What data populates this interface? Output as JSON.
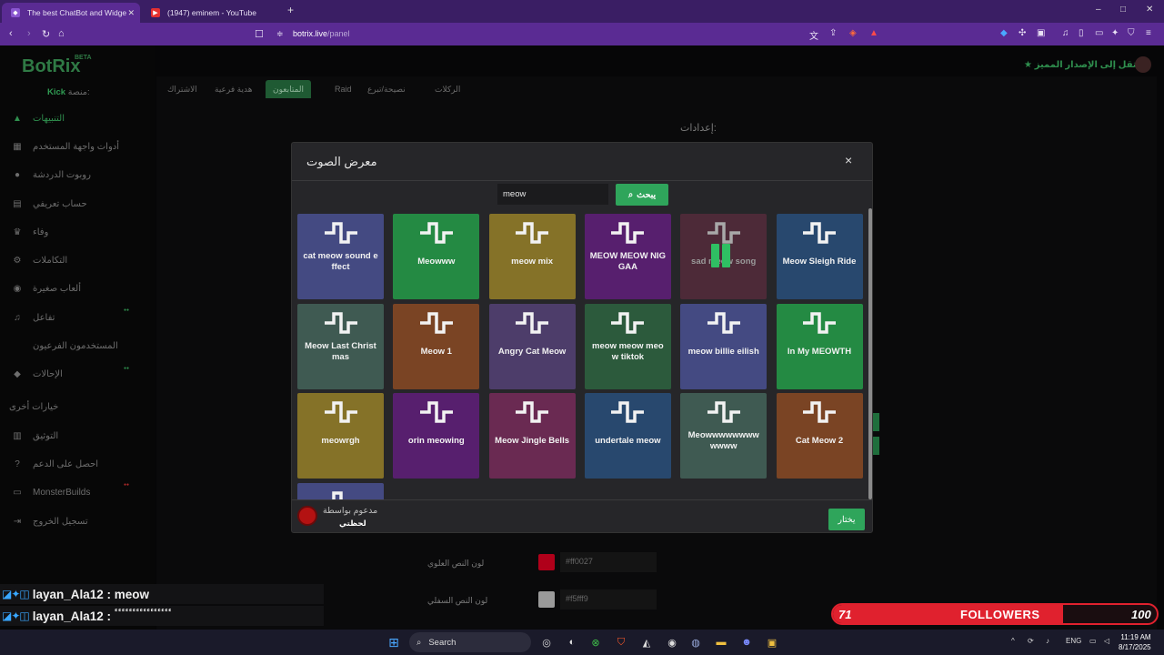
{
  "browser": {
    "tabs": [
      {
        "title": "The best ChatBot and Widge",
        "active": true
      },
      {
        "title": "(1947) eminem - YouTube",
        "active": false
      }
    ],
    "new_tab": "+",
    "url_domain": "botrix.live",
    "url_path": "/panel",
    "window_controls": {
      "minimize": "–",
      "maximize": "□",
      "close": "✕"
    }
  },
  "app": {
    "logo": "BotRix",
    "logo_badge": "BETA",
    "platform_label": "منصة:",
    "platform_value": "Kick",
    "premium_link": "انتقل إلى الإصدار المميز",
    "sidebar": {
      "items": [
        {
          "label": "التنبيهات",
          "icon": "alert-icon",
          "glyph": "▲",
          "active": true
        },
        {
          "label": "أدوات واجهة المستخدم",
          "icon": "widgets-icon",
          "glyph": "▦",
          "active": false
        },
        {
          "label": "روبوت الدردشة",
          "icon": "robot-icon",
          "glyph": "●",
          "active": false
        },
        {
          "label": "حساب تعريفي",
          "icon": "id-card-icon",
          "glyph": "▤",
          "active": false
        },
        {
          "label": "وفاء",
          "icon": "trophy-icon",
          "glyph": "♛",
          "active": false
        },
        {
          "label": "التكاملات",
          "icon": "integrations-icon",
          "glyph": "⚙",
          "active": false
        },
        {
          "label": "ألعاب صغيرة",
          "icon": "gamepad-icon",
          "glyph": "◉",
          "active": false
        },
        {
          "label": "تفاعل",
          "icon": "music-icon",
          "glyph": "♫",
          "active": false
        },
        {
          "label": "المستخدمون الفرعيون",
          "icon": "",
          "glyph": "",
          "active": false
        },
        {
          "label": "الإحالات",
          "icon": "users-icon",
          "glyph": "◆",
          "active": false
        }
      ],
      "other_section": "خيارات أخرى",
      "other_items": [
        {
          "label": "التوثيق",
          "icon": "docs-icon",
          "glyph": "▥"
        },
        {
          "label": "احصل على الدعم",
          "icon": "help-icon",
          "glyph": "?"
        },
        {
          "label": "MonsterBuilds",
          "icon": "monitor-icon",
          "glyph": "▭"
        },
        {
          "label": "تسجيل الخروج",
          "icon": "logout-icon",
          "glyph": "⇥"
        }
      ]
    },
    "page_tabs": [
      "الركلات",
      "نصيحة/تبرع",
      "Raid",
      "المتابعون",
      "هدية فرعية",
      "الاشتراك"
    ],
    "active_page_tab": "المتابعون",
    "settings_title": "إعدادات:",
    "top_text_color_label": "لون النص العلوي",
    "top_text_color_value": "#ff0027",
    "bottom_text_color_label": "لون النص السفلي",
    "bottom_text_color_value": "#f5fff9"
  },
  "modal": {
    "title": "معرض الصوت",
    "close": "×",
    "search_value": "meow",
    "search_button": "يبحث",
    "sounds": [
      {
        "label": "cat meow sound effect",
        "color": "#444a82"
      },
      {
        "label": "Meowww",
        "color": "#248a43"
      },
      {
        "label": "meow mix",
        "color": "#857228"
      },
      {
        "label": "MEOW MEOW NIGGAA",
        "color": "#571f6e"
      },
      {
        "label": "sad meow song",
        "color": "#4d2a38",
        "playing": true
      },
      {
        "label": "Meow Sleigh Ride",
        "color": "#28486e"
      },
      {
        "label": "Meow Last Christmas",
        "color": "#3f5a52"
      },
      {
        "label": "Meow 1",
        "color": "#7a4424"
      },
      {
        "label": "Angry Cat Meow",
        "color": "#4d3d6a"
      },
      {
        "label": "meow meow meow tiktok",
        "color": "#2c5a3c"
      },
      {
        "label": "meow billie eilish",
        "color": "#444a82"
      },
      {
        "label": "In My MEOWTH",
        "color": "#248a43"
      },
      {
        "label": "meowrgh",
        "color": "#857228"
      },
      {
        "label": "orin meowing",
        "color": "#571f6e"
      },
      {
        "label": "Meow Jingle Bells",
        "color": "#6a2a52"
      },
      {
        "label": "undertale meow",
        "color": "#28486e"
      },
      {
        "label": "Meowwwwwwwwwwww",
        "color": "#3f5a52"
      },
      {
        "label": "Cat Meow 2",
        "color": "#7a4424"
      },
      {
        "label": "",
        "color": "#444a82"
      }
    ],
    "sponsor_text": "مدعوم بواسطة",
    "sponsor_name": "لحظتي",
    "choose_button": "يختار"
  },
  "stream": {
    "chat": [
      {
        "user": "layan_Ala12",
        "message": "meow"
      },
      {
        "user": "layan_Ala12",
        "message": "ٴٴٴٴٴٴٴٴٴٴٴٴٴٴٴٴ"
      }
    ],
    "followers": {
      "current": "71",
      "label": "FOLLOWERS",
      "goal": "100",
      "progress": 0.71
    }
  },
  "taskbar": {
    "search_placeholder": "Search",
    "language": "ENG",
    "time": "11:19 AM",
    "date": "8/17/2025"
  }
}
